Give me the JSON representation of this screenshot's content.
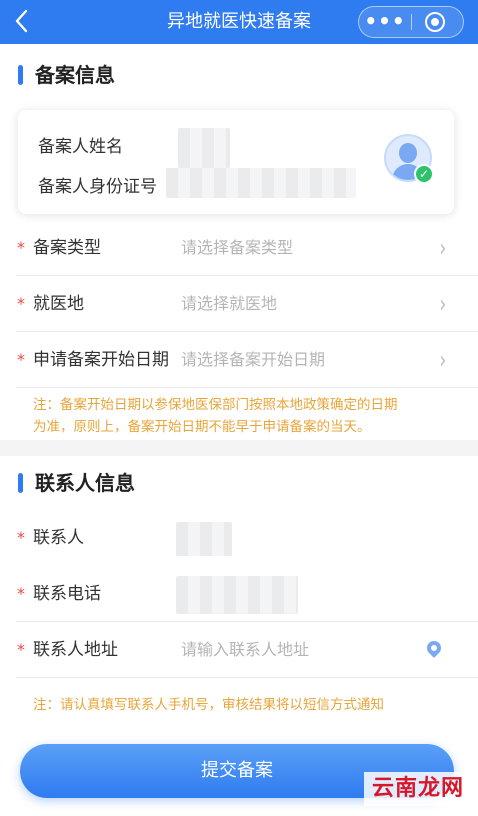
{
  "navbar": {
    "title": "异地就医快速备案",
    "back_icon": "chevron-left-icon",
    "more_icon": "more-dots-icon",
    "more_glyph": "•••",
    "target_icon": "target-icon"
  },
  "section1": {
    "title": "备案信息",
    "card": {
      "name_label": "备案人姓名",
      "id_label": "备案人身份证号",
      "avatar_icon": "user-avatar-icon",
      "verified_icon": "verified-check-icon",
      "verified_glyph": "✓"
    },
    "fields": [
      {
        "required": "*",
        "label": "备案类型",
        "placeholder": "请选择备案类型",
        "arrow": "›"
      },
      {
        "required": "*",
        "label": "就医地",
        "placeholder": "请选择就医地",
        "arrow": "›"
      },
      {
        "required": "*",
        "label": "申请备案开始日期",
        "placeholder": "请选择备案开始日期",
        "arrow": "›"
      }
    ],
    "note_line1": "注：备案开始日期以参保地医保部门按照本地政策确定的日期",
    "note_line2": "为准，原则上，备案开始日期不能早于申请备案的当天。"
  },
  "section2": {
    "title": "联系人信息",
    "fields": [
      {
        "required": "*",
        "label": "联系人"
      },
      {
        "required": "*",
        "label": "联系电话"
      },
      {
        "required": "*",
        "label": "联系人地址",
        "placeholder": "请输入联系人地址",
        "icon": "location-pin-icon"
      }
    ],
    "note": "注：请认真填写联系人手机号，审核结果将以短信方式通知"
  },
  "submit_label": "提交备案",
  "watermark": "云南龙网",
  "colors": {
    "primary": "#2f7bf0",
    "required": "#e54d42",
    "note": "#e7a53a",
    "placeholder": "#b5b5b5"
  }
}
